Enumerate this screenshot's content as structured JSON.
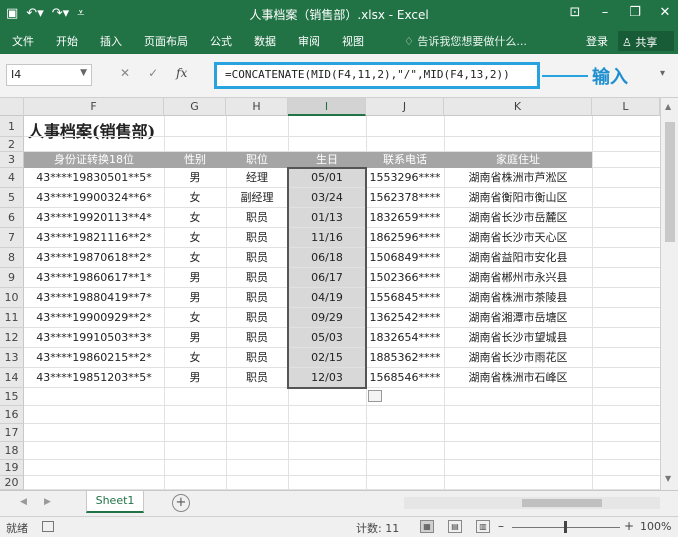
{
  "titlebar": {
    "title": "人事档案（销售部）.xlsx - Excel",
    "save_icon": "save-icon",
    "undo_icon": "undo-icon",
    "redo_icon": "redo-icon",
    "customize_icon": "customize-qat-icon",
    "ribbon_display_icon": "ribbon-display-icon",
    "minimize_icon": "minimize-icon",
    "restore_icon": "restore-icon",
    "close_icon": "close-icon"
  },
  "ribbon": {
    "tabs": [
      "文件",
      "开始",
      "插入",
      "页面布局",
      "公式",
      "数据",
      "审阅",
      "视图"
    ],
    "tell_me": "告诉我您想要做什么...",
    "login": "登录",
    "share": "共享"
  },
  "formula_bar": {
    "name_box": "I4",
    "formula": "=CONCATENATE(MID(F4,11,2),\"/\",MID(F4,13,2))",
    "annotation": "输入"
  },
  "columns": [
    "F",
    "G",
    "H",
    "I",
    "J",
    "K",
    "L"
  ],
  "selected_column": "I",
  "rows": [
    "1",
    "2",
    "3",
    "4",
    "5",
    "6",
    "7",
    "8",
    "9",
    "10",
    "11",
    "12",
    "13",
    "14",
    "15",
    "16",
    "17",
    "18",
    "19",
    "20"
  ],
  "sheet": {
    "title": "人事档案(销售部)",
    "headers": [
      "身份证转换18位",
      "性别",
      "职位",
      "生日",
      "联系电话",
      "家庭住址"
    ],
    "data": [
      [
        "43****19830501**5*",
        "男",
        "经理",
        "05/01",
        "1553296****",
        "湖南省株洲市芦淞区"
      ],
      [
        "43****19900324**6*",
        "女",
        "副经理",
        "03/24",
        "1562378****",
        "湖南省衡阳市衡山区"
      ],
      [
        "43****19920113**4*",
        "女",
        "职员",
        "01/13",
        "1832659****",
        "湖南省长沙市岳麓区"
      ],
      [
        "43****19821116**2*",
        "女",
        "职员",
        "11/16",
        "1862596****",
        "湖南省长沙市天心区"
      ],
      [
        "43****19870618**2*",
        "女",
        "职员",
        "06/18",
        "1506849****",
        "湖南省益阳市安化县"
      ],
      [
        "43****19860617**1*",
        "男",
        "职员",
        "06/17",
        "1502366****",
        "湖南省郴州市永兴县"
      ],
      [
        "43****19880419**7*",
        "男",
        "职员",
        "04/19",
        "1556845****",
        "湖南省株洲市茶陵县"
      ],
      [
        "43****19900929**2*",
        "女",
        "职员",
        "09/29",
        "1362542****",
        "湖南省湘潭市岳塘区"
      ],
      [
        "43****19910503**3*",
        "男",
        "职员",
        "05/03",
        "1832654****",
        "湖南省长沙市望城县"
      ],
      [
        "43****19860215**2*",
        "女",
        "职员",
        "02/15",
        "1885362****",
        "湖南省长沙市雨花区"
      ],
      [
        "43****19851203**5*",
        "男",
        "职员",
        "12/03",
        "1568546****",
        "湖南省株洲市石峰区"
      ]
    ]
  },
  "sheet_tabs": {
    "active": "Sheet1",
    "add_icon": "add-sheet-icon"
  },
  "status": {
    "ready": "就绪",
    "count": "计数: 11",
    "zoom": "100%"
  },
  "colors": {
    "accent": "#217346",
    "header_fill": "#a5a5a5",
    "annotation": "#29a3e0"
  }
}
